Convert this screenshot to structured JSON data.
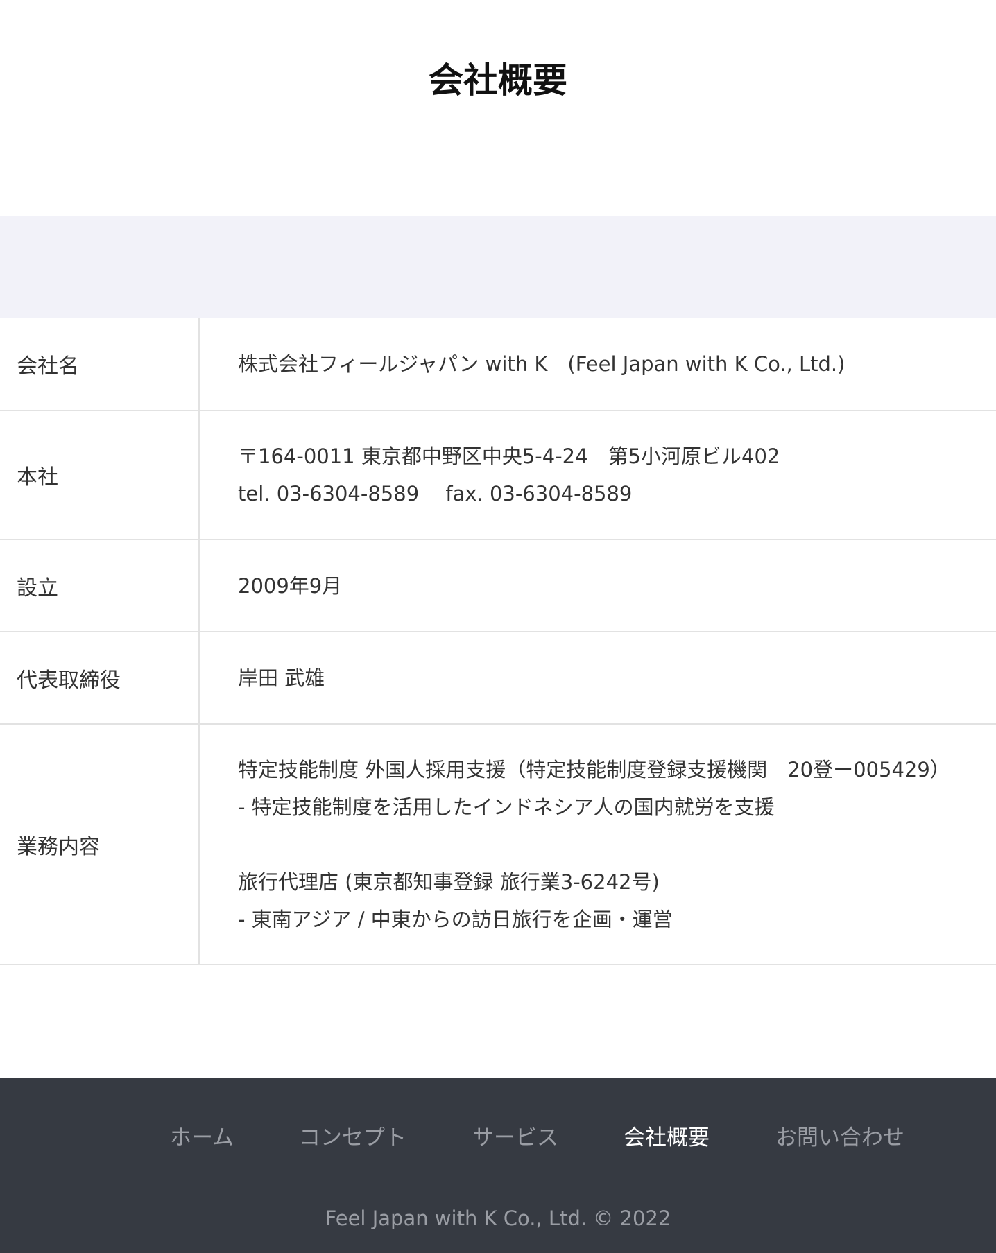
{
  "page": {
    "title": "会社概要"
  },
  "company": {
    "rows": [
      {
        "label": "会社名",
        "lines": [
          "株式会社フィールジャパン with K　(Feel Japan with K Co., Ltd.)"
        ]
      },
      {
        "label": "本社",
        "lines": [
          "〒164-0011 東京都中野区中央5-4-24　第5小河原ビル402",
          "tel. 03-6304-8589　 fax. 03-6304-8589"
        ]
      },
      {
        "label": "設立",
        "lines": [
          "2009年9月"
        ]
      },
      {
        "label": "代表取締役",
        "lines": [
          "岸田 武雄"
        ]
      },
      {
        "label": "業務内容",
        "lines": [
          "特定技能制度 外国人採用支援（特定技能制度登録支援機関　20登ー005429）",
          "- 特定技能制度を活用したインドネシア人の国内就労を支援",
          "旅行代理店 (東京都知事登録 旅行業3-6242号)",
          "- 東南アジア / 中東からの訪日旅行を企画・運営"
        ]
      }
    ]
  },
  "footer": {
    "nav": [
      {
        "label": "ホーム",
        "active": false
      },
      {
        "label": "コンセプト",
        "active": false
      },
      {
        "label": "サービス",
        "active": false
      },
      {
        "label": "会社概要",
        "active": true
      },
      {
        "label": "お問い合わせ",
        "active": false
      }
    ],
    "copyright": "Feel Japan with K Co., Ltd. © 2022"
  }
}
